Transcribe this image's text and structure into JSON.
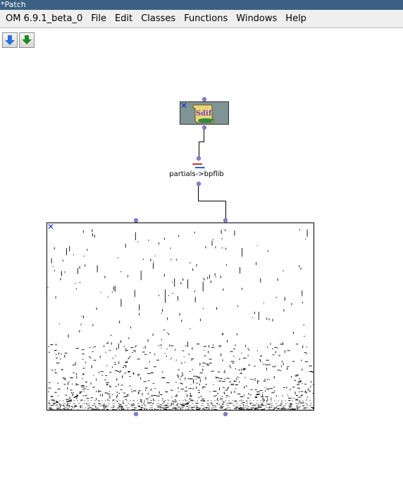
{
  "window": {
    "title": "*Patch"
  },
  "menubar": {
    "items": [
      "OM 6.9.1_beta_0",
      "File",
      "Edit",
      "Classes",
      "Functions",
      "Windows",
      "Help"
    ]
  },
  "toolbar": {
    "buttons": [
      {
        "icon": "arrow-down-blue-icon",
        "color": "#2a6fdb"
      },
      {
        "icon": "arrow-down-green-icon",
        "color": "#1f8a1f"
      }
    ]
  },
  "patch": {
    "sdif_box": {
      "icon": "sdif-file-icon",
      "logo_text": "Sdif"
    },
    "function_box": {
      "label": "partials->bpflib",
      "icon": "conversion-arrows-icon"
    },
    "bpflib_box": {
      "content": "partials-plot"
    }
  },
  "colors": {
    "titlebar": "#3a6184",
    "inlet": "#8a86d4",
    "selection_mark": "#1f2bd8",
    "sdif_box_bg": "#7f9494"
  }
}
